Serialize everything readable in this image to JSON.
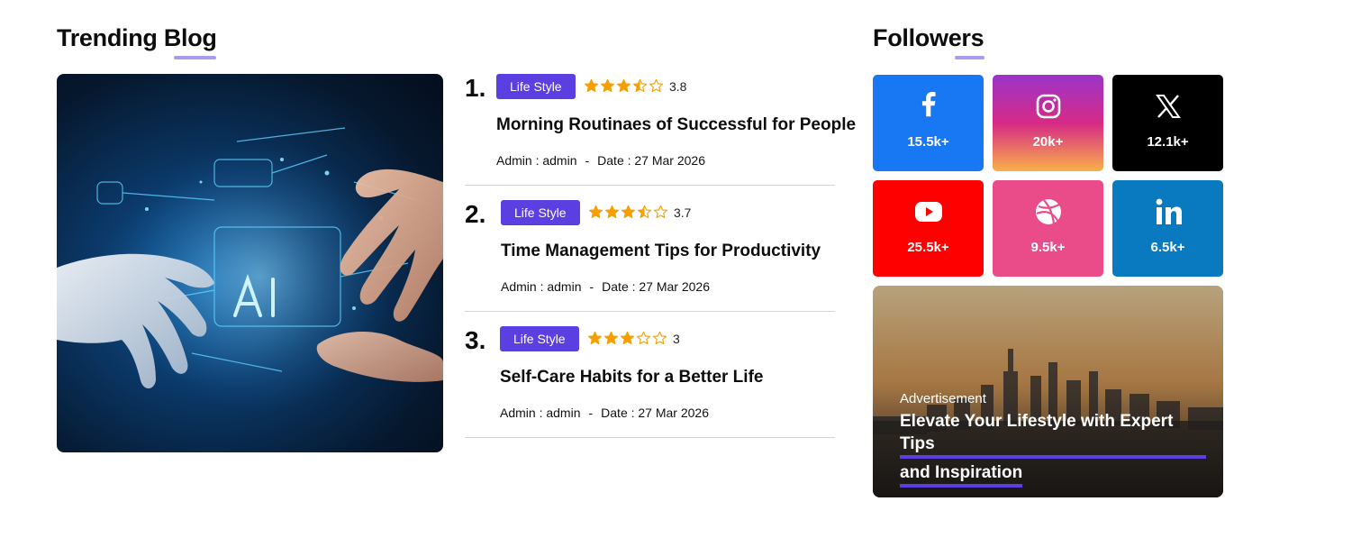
{
  "trending": {
    "title_part1": "Trending",
    "title_part2": "Blog",
    "posts": [
      {
        "num": "1.",
        "category": "Life Style",
        "rating": "3.8",
        "stars": 3.5,
        "title": "Morning Routinaes of Successful for People",
        "author": "Admin : admin",
        "sep": "-",
        "date": "Date : 27 Mar 2026"
      },
      {
        "num": "2.",
        "category": "Life Style",
        "rating": "3.7",
        "stars": 3.5,
        "title": "Time Management Tips for Productivity",
        "author": "Admin : admin",
        "sep": "-",
        "date": "Date : 27 Mar 2026"
      },
      {
        "num": "3.",
        "category": "Life Style",
        "rating": "3",
        "stars": 3,
        "title": "Self-Care Habits for a Better Life",
        "author": "Admin : admin",
        "sep": "-",
        "date": "Date : 27 Mar 2026"
      }
    ]
  },
  "followers": {
    "title_part1": "Follow",
    "title_part2": "ers",
    "items": [
      {
        "network": "facebook",
        "icon": "facebook-icon",
        "count": "15.5k+",
        "color": "#1877f2"
      },
      {
        "network": "instagram",
        "icon": "instagram-icon",
        "count": "20k+",
        "color": "#d62976"
      },
      {
        "network": "x",
        "icon": "x-icon",
        "count": "12.1k+",
        "color": "#000000"
      },
      {
        "network": "youtube",
        "icon": "youtube-icon",
        "count": "25.5k+",
        "color": "#ff0000"
      },
      {
        "network": "dribbble",
        "icon": "dribbble-icon",
        "count": "9.5k+",
        "color": "#ea4c89"
      },
      {
        "network": "linkedin",
        "icon": "linkedin-icon",
        "count": "6.5k+",
        "color": "#0a7ac0"
      }
    ]
  },
  "advertisement": {
    "label": "Advertisement",
    "headline_line1": "Elevate Your Lifestyle with Expert Tips",
    "headline_line2": "and Inspiration"
  },
  "colors": {
    "accent": "#5b3fe0",
    "underline": "#a99cf0",
    "star": "#f5a000"
  }
}
